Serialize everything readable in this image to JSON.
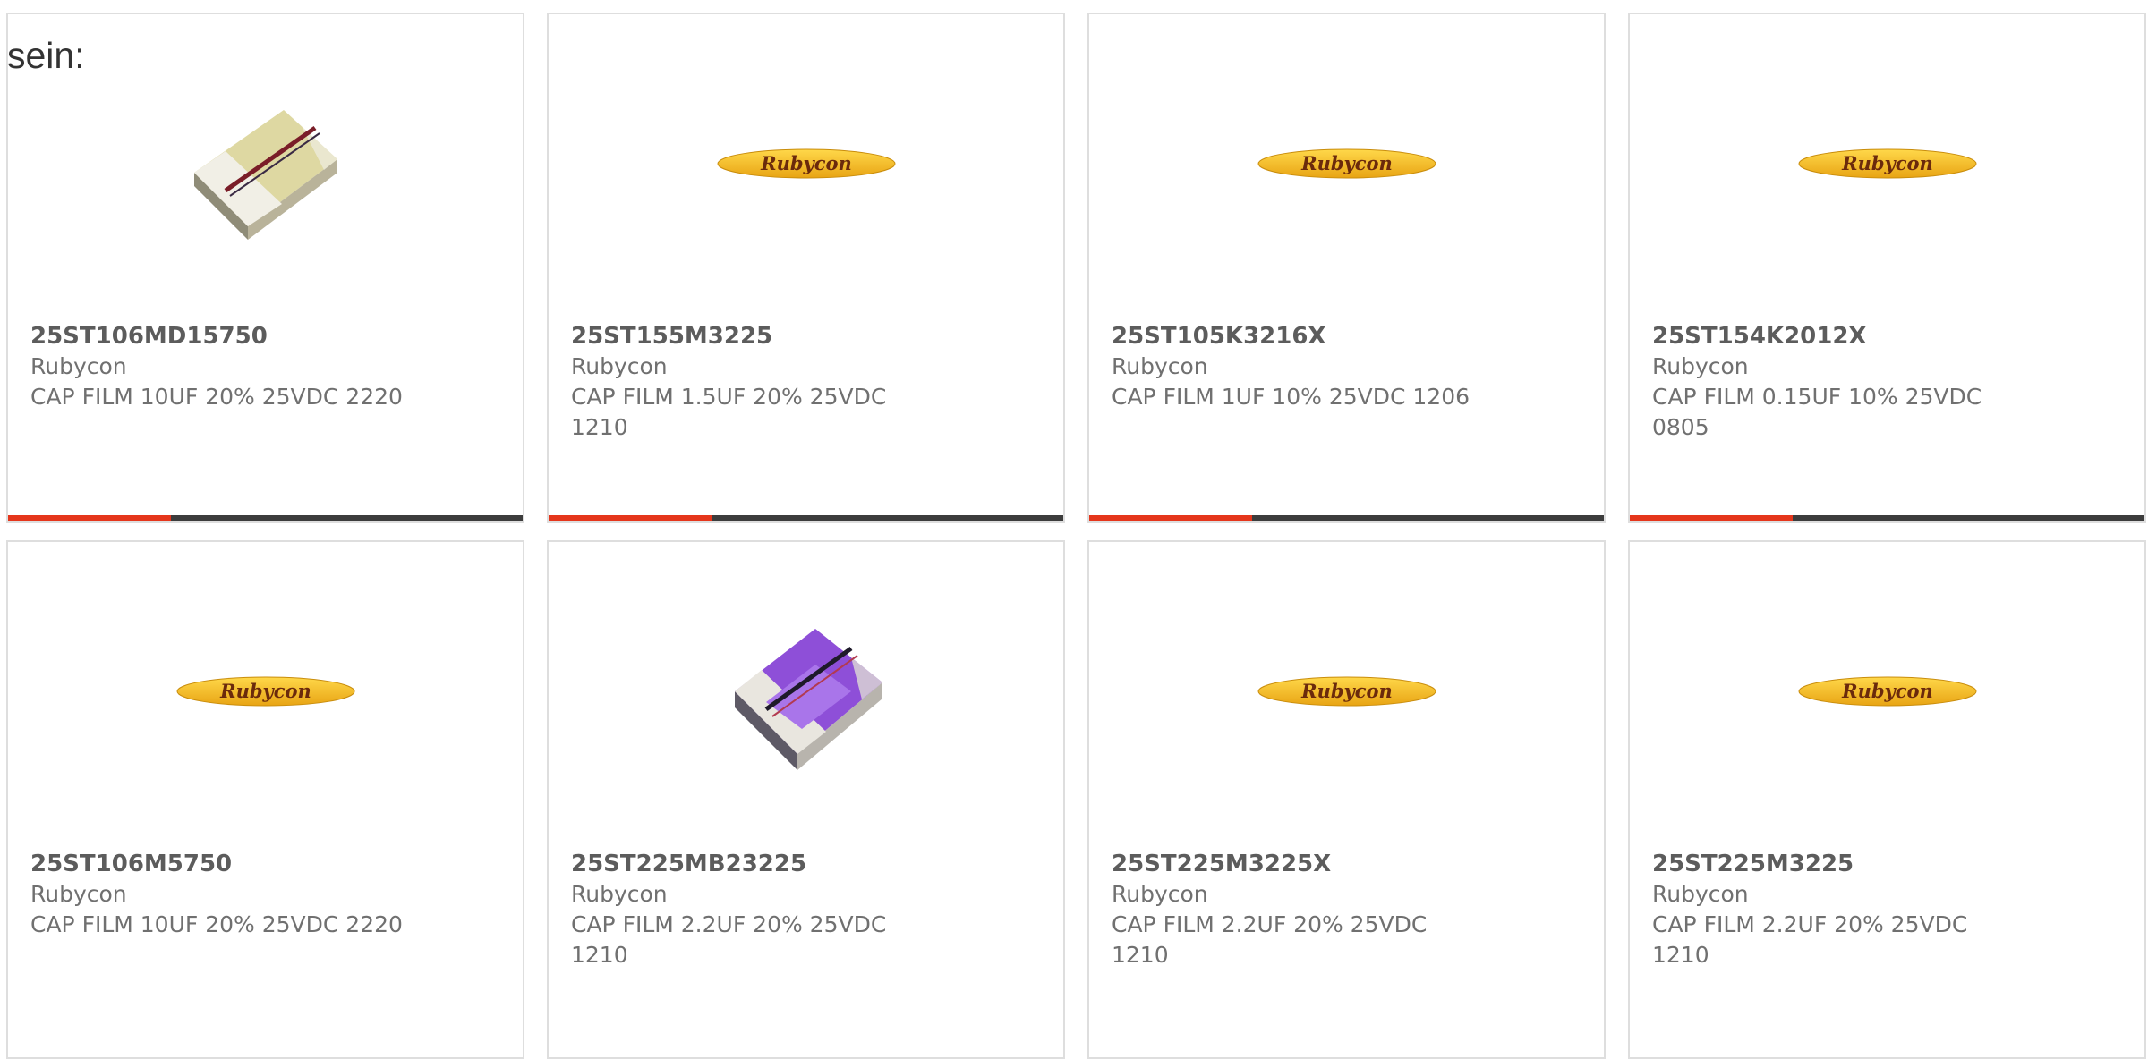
{
  "intro_text": "sein:",
  "brand_logo_text": "Rubycon",
  "colors": {
    "accent": "#e5361b",
    "bar": "#3c3c3c",
    "border": "#dedede",
    "logo_yellow": "#f4b81a"
  },
  "products": [
    {
      "part_number": "25ST106MD15750",
      "manufacturer": "Rubycon",
      "description": "CAP FILM 10UF 20% 25VDC 2220",
      "image": "capacitor-chip-gold"
    },
    {
      "part_number": "25ST155M3225",
      "manufacturer": "Rubycon",
      "description": "CAP FILM 1.5UF 20% 25VDC 1210",
      "image": "rubycon-logo"
    },
    {
      "part_number": "25ST105K3216X",
      "manufacturer": "Rubycon",
      "description": "CAP FILM 1UF 10% 25VDC 1206",
      "image": "rubycon-logo"
    },
    {
      "part_number": "25ST154K2012X",
      "manufacturer": "Rubycon",
      "description": "CAP FILM 0.15UF 10% 25VDC 0805",
      "image": "rubycon-logo"
    },
    {
      "part_number": "25ST106M5750",
      "manufacturer": "Rubycon",
      "description": "CAP FILM 10UF 20% 25VDC 2220",
      "image": "rubycon-logo"
    },
    {
      "part_number": "25ST225MB23225",
      "manufacturer": "Rubycon",
      "description": "CAP FILM 2.2UF 20% 25VDC 1210",
      "image": "capacitor-chip-purple"
    },
    {
      "part_number": "25ST225M3225X",
      "manufacturer": "Rubycon",
      "description": "CAP FILM 2.2UF 20% 25VDC 1210",
      "image": "rubycon-logo"
    },
    {
      "part_number": "25ST225M3225",
      "manufacturer": "Rubycon",
      "description": "CAP FILM 2.2UF 20% 25VDC 1210",
      "image": "rubycon-logo"
    }
  ]
}
